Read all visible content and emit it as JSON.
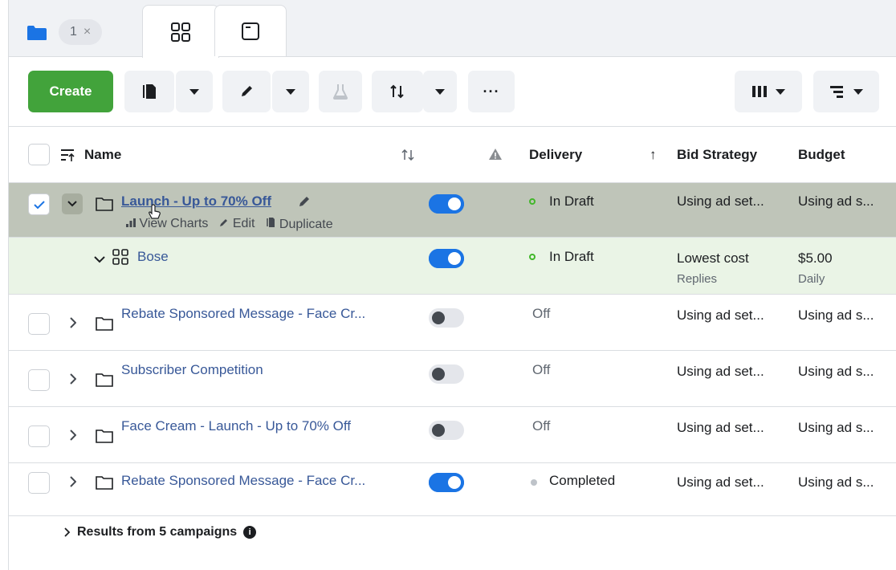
{
  "tabs": {
    "campaign_count": "1",
    "close_glyph": "×",
    "campaigns_icon": "folder-icon",
    "adsets_icon": "grid-icon",
    "ads_icon": "window-icon"
  },
  "toolbar": {
    "create_label": "Create",
    "more_label": "···",
    "icons": [
      "duplicate-icon",
      "pencil-icon",
      "flask-icon",
      "sort-icon",
      "columns-icon",
      "breakdown-icon"
    ]
  },
  "table": {
    "headers": {
      "name": "Name",
      "delivery": "Delivery",
      "delivery_sort": "↑",
      "bid_strategy": "Bid Strategy",
      "budget": "Budget"
    },
    "selected": {
      "name": "Launch - Up to 70% Off",
      "actions": {
        "view_charts": "View Charts",
        "edit": "Edit",
        "duplicate": "Duplicate"
      },
      "delivery": "In Draft",
      "bid_strategy": "Using ad set...",
      "budget": "Using ad s...",
      "toggle_on": true
    },
    "adset": {
      "name": "Bose",
      "delivery": "In Draft",
      "bid_strategy": "Lowest cost",
      "bid_sub": "Replies",
      "budget": "$5.00",
      "budget_sub": "Daily",
      "toggle_on": true
    },
    "rows": [
      {
        "name": "Rebate Sponsored Message - Face Cr...",
        "delivery": "Off",
        "bid_strategy": "Using ad set...",
        "budget": "Using ad s...",
        "toggle_on": false
      },
      {
        "name": "Subscriber Competition",
        "delivery": "Off",
        "bid_strategy": "Using ad set...",
        "budget": "Using ad s...",
        "toggle_on": false
      },
      {
        "name": "Face Cream - Launch - Up to 70% Off",
        "delivery": "Off",
        "bid_strategy": "Using ad set...",
        "budget": "Using ad s...",
        "toggle_on": false
      },
      {
        "name": "Rebate Sponsored Message - Face Cr...",
        "delivery": "Completed",
        "bid_strategy": "Using ad set...",
        "budget": "Using ad s...",
        "toggle_on": true
      }
    ]
  },
  "footer": {
    "results_label": "Results from 5 campaigns"
  },
  "colors": {
    "create_green": "#42a33b",
    "link_blue": "#385898",
    "toggle_blue": "#1b74e4",
    "selected_row": "#bfc5b9",
    "adset_row": "#eaf4e6"
  }
}
